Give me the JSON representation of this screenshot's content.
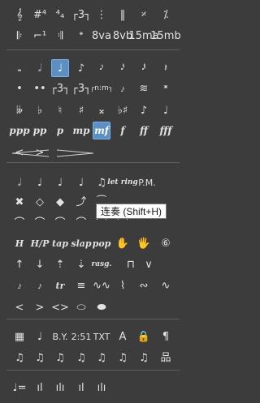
{
  "palette": {
    "rows": [
      {
        "items": [
          {
            "name": "treble-clef-tab-icon",
            "label": "𝄞"
          },
          {
            "name": "key-signature-sharps-icon",
            "label": "#⁴"
          },
          {
            "name": "time-signature-4-4-icon",
            "label": "⁴₄"
          },
          {
            "name": "triplet-bracket-icon",
            "label": "┌3┐"
          },
          {
            "name": "dotted-barline-icon",
            "label": "⋮"
          },
          {
            "name": "double-barline-icon",
            "label": "‖"
          },
          {
            "name": "repeat-measure-icon",
            "label": "𝄎"
          },
          {
            "name": "double-repeat-measure-icon",
            "label": "⁒"
          }
        ]
      },
      {
        "items": [
          {
            "name": "repeat-start-icon",
            "label": "𝄆"
          },
          {
            "name": "volta-bracket-icon",
            "label": "⌐¹"
          },
          {
            "name": "repeat-end-icon",
            "label": "𝄇"
          },
          {
            "name": "coda-icon",
            "label": "𝄌"
          },
          {
            "name": "ottava-alta-button",
            "label": "8va"
          },
          {
            "name": "ottava-bassa-button",
            "label": "8vb"
          },
          {
            "name": "quindicesima-alta-button",
            "label": "15ma"
          },
          {
            "name": "quindicesima-bassa-button",
            "label": "15mb"
          }
        ]
      },
      {
        "items": [
          {
            "name": "whole-note-icon",
            "label": "𝅝"
          },
          {
            "name": "half-note-icon",
            "label": "𝅗𝅥"
          },
          {
            "name": "quarter-note-icon",
            "label": "♩",
            "selected": true
          },
          {
            "name": "eighth-note-icon",
            "label": "♪"
          },
          {
            "name": "sixteenth-note-icon",
            "label": "𝅘𝅥𝅯"
          },
          {
            "name": "thirty-second-note-icon",
            "label": "𝅘𝅥𝅰"
          },
          {
            "name": "sixty-fourth-note-icon",
            "label": "𝅘𝅥𝅱"
          },
          {
            "name": "quarter-rest-icon",
            "label": "𝄽"
          }
        ]
      },
      {
        "items": [
          {
            "name": "dot-icon",
            "label": "•"
          },
          {
            "name": "double-dot-icon",
            "label": "••"
          },
          {
            "name": "triplet-icon",
            "label": "┌3┐"
          },
          {
            "name": "tuplet-icon",
            "label": "┌3┐"
          },
          {
            "name": "tuplet-custom-icon",
            "label": "┌n:m┐"
          },
          {
            "name": "grace-note-icon",
            "label": "𝆔"
          },
          {
            "name": "tremolo-icon",
            "label": "≋"
          },
          {
            "name": "ghost-note-icon",
            "label": "𝄺"
          }
        ]
      },
      {
        "items": [
          {
            "name": "double-flat-icon",
            "label": "𝄫"
          },
          {
            "name": "flat-icon",
            "label": "♭"
          },
          {
            "name": "natural-icon",
            "label": "♮"
          },
          {
            "name": "sharp-icon",
            "label": "♯"
          },
          {
            "name": "double-sharp-icon",
            "label": "𝄪"
          },
          {
            "name": "sharp-flat-icon",
            "label": "♭♯"
          },
          {
            "name": "eighth-note-stem-icon",
            "label": "♪"
          },
          {
            "name": "quarter-note-stem-icon",
            "label": "♩"
          }
        ]
      },
      {
        "items": [
          {
            "name": "dynamic-ppp-button",
            "label": "ppp",
            "dyn": true
          },
          {
            "name": "dynamic-pp-button",
            "label": "pp",
            "dyn": true
          },
          {
            "name": "dynamic-p-button",
            "label": "p",
            "dyn": true
          },
          {
            "name": "dynamic-mp-button",
            "label": "mp",
            "dyn": true
          },
          {
            "name": "dynamic-mf-button",
            "label": "mf",
            "dyn": true,
            "selected": true
          },
          {
            "name": "dynamic-f-button",
            "label": "f",
            "dyn": true
          },
          {
            "name": "dynamic-ff-button",
            "label": "ff",
            "dyn": true
          },
          {
            "name": "dynamic-fff-button",
            "label": "fff",
            "dyn": true
          }
        ]
      },
      {
        "items": [
          {
            "name": "crescendo-icon",
            "label": "<"
          },
          {
            "name": "decrescendo-icon",
            "label": ">"
          }
        ]
      },
      {
        "items": [
          {
            "name": "let-ring-note-icon",
            "label": "𝅗𝅥"
          },
          {
            "name": "staccato-note-icon",
            "label": "♩"
          },
          {
            "name": "accent-note-icon",
            "label": "♩"
          },
          {
            "name": "tenuto-note-icon",
            "label": "♩"
          },
          {
            "name": "tie-notes-icon",
            "label": "♫"
          },
          {
            "name": "let-ring-button",
            "label": "let ring",
            "ital": true
          },
          {
            "name": "palm-mute-button",
            "label": "P.M.",
            "plain": true
          }
        ]
      },
      {
        "items": [
          {
            "name": "dead-note-icon",
            "label": "✖"
          },
          {
            "name": "harmonic-natural-icon",
            "label": "◇"
          },
          {
            "name": "harmonic-artificial-icon",
            "label": "◆"
          },
          {
            "name": "slide-up-icon",
            "label": "⤴"
          },
          {
            "name": "legato-icon",
            "label": "⁀"
          }
        ]
      },
      {
        "items": [
          {
            "name": "bend-icon",
            "label": "⌒"
          },
          {
            "name": "bend-release-icon",
            "label": "⌒"
          },
          {
            "name": "pre-bend-icon",
            "label": "⌒"
          },
          {
            "name": "pre-bend-release-icon",
            "label": "⌒"
          },
          {
            "name": "bend-custom-icon",
            "label": "⌒"
          },
          {
            "name": "whammy-bar-icon",
            "label": "⌒"
          }
        ]
      },
      {
        "items": [
          {
            "name": "hammer-on-button",
            "label": "H",
            "ital": true
          },
          {
            "name": "hammer-pull-button",
            "label": "H/P",
            "ital": true
          },
          {
            "name": "tap-button",
            "label": "tap",
            "ital": true
          },
          {
            "name": "slap-button",
            "label": "slap",
            "ital": true
          },
          {
            "name": "pop-button",
            "label": "pop",
            "ital": true
          },
          {
            "name": "left-hand-icon",
            "label": "✋"
          },
          {
            "name": "right-hand-icon",
            "label": "🖐"
          },
          {
            "name": "string-number-icon",
            "label": "⑥"
          }
        ]
      },
      {
        "items": [
          {
            "name": "pick-up-icon",
            "label": "↑"
          },
          {
            "name": "pick-down-icon",
            "label": "↓"
          },
          {
            "name": "arpeggio-up-icon",
            "label": "⇡"
          },
          {
            "name": "arpeggio-down-icon",
            "label": "⇣"
          },
          {
            "name": "rasgueado-button",
            "label": "rasg.",
            "ital": true
          },
          {
            "name": "downstroke-icon",
            "label": "⊓"
          },
          {
            "name": "upstroke-icon",
            "label": "∨"
          }
        ]
      },
      {
        "items": [
          {
            "name": "grace-before-icon",
            "label": "𝆔"
          },
          {
            "name": "grace-on-beat-icon",
            "label": "𝆔"
          },
          {
            "name": "trill-button",
            "label": "tr",
            "ital": true
          },
          {
            "name": "tremolo-picking-icon",
            "label": "≡"
          },
          {
            "name": "vibrato-icon",
            "label": "∿∿"
          },
          {
            "name": "wide-vibrato-icon",
            "label": "⌇"
          },
          {
            "name": "turn-icon",
            "label": "∾"
          },
          {
            "name": "inverted-turn-icon",
            "label": "∿"
          }
        ]
      },
      {
        "items": [
          {
            "name": "fade-in-icon",
            "label": "<"
          },
          {
            "name": "fade-out-icon",
            "label": ">"
          },
          {
            "name": "volume-swell-icon",
            "label": "<>"
          },
          {
            "name": "wah-open-icon",
            "label": "⬭"
          },
          {
            "name": "wah-closed-icon",
            "label": "⬬"
          }
        ]
      },
      {
        "items": [
          {
            "name": "chord-diagram-icon",
            "label": "▦"
          },
          {
            "name": "chord-name-icon",
            "label": "♩"
          },
          {
            "name": "beat-text-button",
            "label": "B.Y.",
            "plain": true
          },
          {
            "name": "tempo-button",
            "label": "2:51",
            "plain": true
          },
          {
            "name": "text-button",
            "label": "TXT",
            "plain": true
          },
          {
            "name": "section-marker-icon",
            "label": "A"
          },
          {
            "name": "lock-icon",
            "label": "🔒"
          },
          {
            "name": "paragraph-icon",
            "label": "¶"
          }
        ]
      },
      {
        "items": [
          {
            "name": "auto-beam-icon",
            "label": "♫"
          },
          {
            "name": "beam-break-icon",
            "label": "♫"
          },
          {
            "name": "beam-join-icon",
            "label": "♫"
          },
          {
            "name": "beam-partial-icon",
            "label": "♫"
          },
          {
            "name": "beam-free-icon",
            "label": "♫"
          },
          {
            "name": "beam-feather-icon",
            "label": "♫"
          },
          {
            "name": "beam-auto-2-icon",
            "label": "♫"
          },
          {
            "name": "chord-grid-icon",
            "label": "品"
          }
        ]
      },
      {
        "items": [
          {
            "name": "tempo-automation-icon",
            "label": "♩="
          },
          {
            "name": "volume-automation-icon",
            "label": "ıl"
          },
          {
            "name": "pan-automation-icon",
            "label": "ılı"
          },
          {
            "name": "wah-automation-icon",
            "label": "ıl"
          },
          {
            "name": "master-automation-icon",
            "label": "ılı"
          }
        ]
      }
    ],
    "tooltip": "连奏 (Shift+H)"
  }
}
